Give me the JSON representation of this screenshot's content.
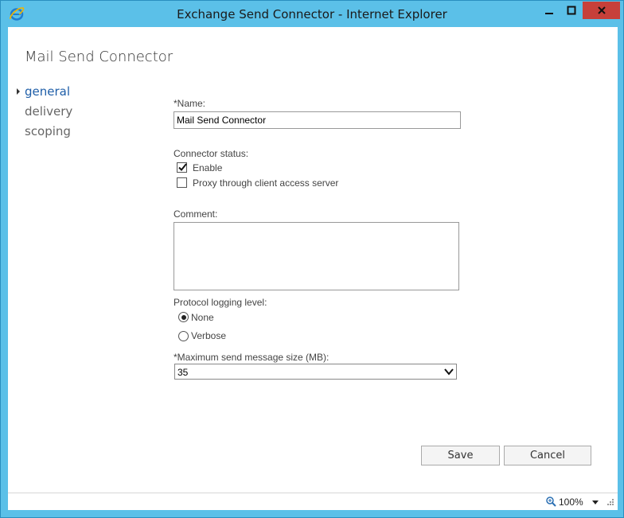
{
  "window": {
    "title": "Exchange Send Connector - Internet Explorer",
    "icon": "internet-explorer-icon"
  },
  "dialog": {
    "title": "Mail Send Connector"
  },
  "nav": {
    "items": [
      {
        "label": "general",
        "active": true
      },
      {
        "label": "delivery",
        "active": false
      },
      {
        "label": "scoping",
        "active": false
      }
    ]
  },
  "form": {
    "name": {
      "label": "*Name:",
      "value": "Mail Send Connector"
    },
    "connector_status": {
      "label": "Connector status:",
      "enable": {
        "label": "Enable",
        "checked": true
      },
      "proxy": {
        "label": "Proxy through client access server",
        "checked": false
      }
    },
    "comment": {
      "label": "Comment:",
      "value": ""
    },
    "protocol_logging": {
      "label": "Protocol logging level:",
      "options": [
        {
          "label": "None",
          "selected": true
        },
        {
          "label": "Verbose",
          "selected": false
        }
      ]
    },
    "max_send_size": {
      "label": "*Maximum send message size (MB):",
      "value": "35"
    }
  },
  "buttons": {
    "save": "Save",
    "cancel": "Cancel"
  },
  "statusbar": {
    "zoom": "100%"
  },
  "colors": {
    "frame": "#5bc0e8",
    "close_button": "#c7403a",
    "nav_active": "#1e5ea8"
  }
}
